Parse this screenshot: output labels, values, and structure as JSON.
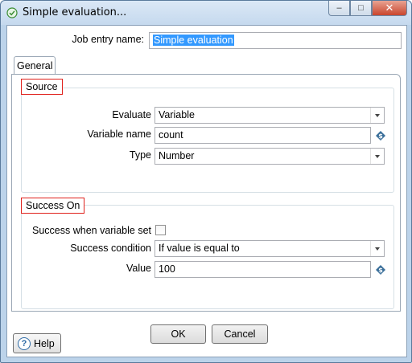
{
  "window": {
    "title": "Simple evaluation...",
    "minimize_glyph": "–",
    "maximize_glyph": "□",
    "close_glyph": "✕"
  },
  "job_entry": {
    "label": "Job entry name:",
    "value": "Simple evaluation"
  },
  "tabs": [
    {
      "label": "General",
      "selected": true
    }
  ],
  "source": {
    "legend": "Source",
    "evaluate_label": "Evaluate",
    "evaluate_value": "Variable",
    "variable_name_label": "Variable name",
    "variable_name_value": "count",
    "type_label": "Type",
    "type_value": "Number"
  },
  "success_on": {
    "legend": "Success On",
    "when_variable_set_label": "Success when variable set",
    "when_variable_set_checked": false,
    "condition_label": "Success condition",
    "condition_value": "If value is equal to",
    "value_label": "Value",
    "value_value": "100"
  },
  "buttons": {
    "ok": "OK",
    "cancel": "Cancel",
    "help": "Help",
    "help_glyph": "?"
  },
  "icons": {
    "title_icon": "check-circle-icon",
    "variable_icon": "variable-dollar-icon"
  },
  "colors": {
    "selection": "#3399ff",
    "legend_border": "#e0201b",
    "title_bar": "#c5d9ee",
    "close_button": "#c9452d"
  }
}
